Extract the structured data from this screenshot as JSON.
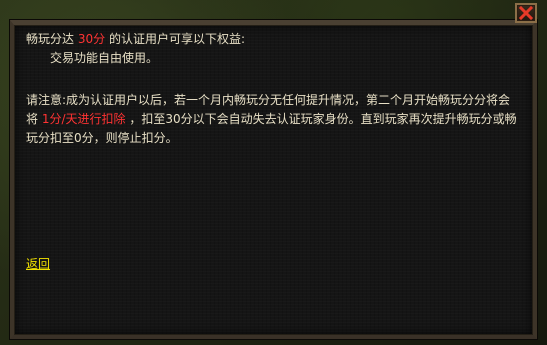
{
  "dialog": {
    "benefit_prefix": "畅玩分达",
    "benefit_points": "30分",
    "benefit_suffix": "的认证用户可享以下权益:",
    "benefit_item": "交易功能自由使用。",
    "note_line1": "请注意:成为认证用户以后，若一个月内畅玩分无任何提升情况，第二个月开始畅玩分分将会",
    "note_line2_prefix": "将",
    "note_line2_red": "1分/天进行扣除",
    "note_line2_suffix": "，扣至30分以下会自动失去认证玩家身份。直到玩家再次提升畅玩分或畅",
    "note_line3": "玩分扣至0分，则停止扣分。",
    "back_label": "返回"
  },
  "colors": {
    "text": "#e8e0c6",
    "highlight": "#ff3333",
    "link": "#f3e300",
    "close_button_border": "#8b6f48",
    "close_x": "#e63a28"
  },
  "icons": {
    "close": "close-icon"
  }
}
